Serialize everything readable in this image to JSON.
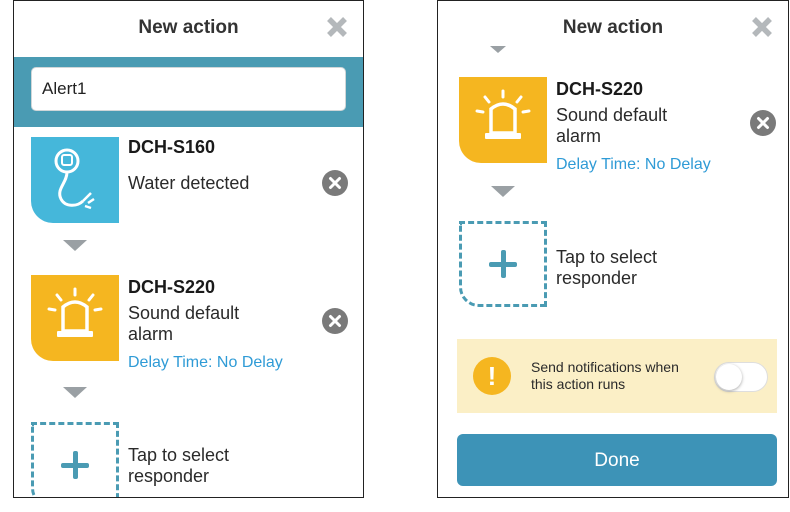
{
  "colors": {
    "accent": "#4a9bb3",
    "sensor_blue": "#45b7da",
    "siren_yellow": "#f5b620",
    "delay_link": "#2f9bd6",
    "notify_bg": "#fbefc6",
    "done_button": "#3d93b7"
  },
  "left": {
    "title": "New action",
    "name_value": "Alert1",
    "trigger": {
      "model": "DCH-S160",
      "description": "Water detected",
      "icon": "water-sensor-icon"
    },
    "responder": {
      "model": "DCH-S220",
      "description": "Sound default alarm",
      "delay": "Delay Time: No Delay",
      "icon": "siren-icon"
    },
    "add_label": "Tap to select responder"
  },
  "right": {
    "title": "New action",
    "responder": {
      "model": "DCH-S220",
      "description": "Sound default alarm",
      "delay": "Delay Time: No Delay",
      "icon": "siren-icon"
    },
    "add_label": "Tap to select responder",
    "notification_text": "Send notifications when this action runs",
    "notification_enabled": false,
    "done_label": "Done"
  }
}
